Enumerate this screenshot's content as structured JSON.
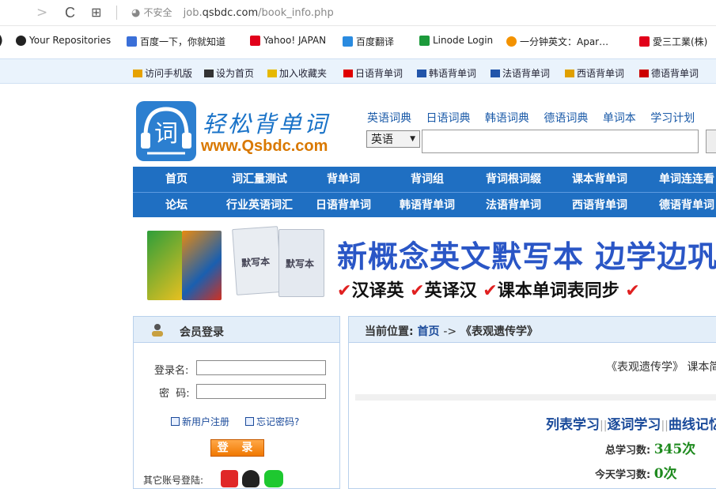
{
  "browser": {
    "back": "<",
    "forward": ">",
    "reload": "C",
    "apps": "⊞",
    "security": "不安全",
    "url_prefix": "job.",
    "url_host": "qsbdc.com",
    "url_path": "/book_info.php"
  },
  "bookmarks": [
    {
      "label": "Your Repositories",
      "icon": "github-icon",
      "color": "#222"
    },
    {
      "label": "百度一下，你就知道",
      "icon": "baidu-icon",
      "color": "#3a6fd8"
    },
    {
      "label": "Yahoo! JAPAN",
      "icon": "yahoo-icon",
      "color": "#e1001a"
    },
    {
      "label": "百度翻译",
      "icon": "translate-icon",
      "color": "#2a8be0"
    },
    {
      "label": "Linode Login",
      "icon": "linode-icon",
      "color": "#1c9a3b"
    },
    {
      "label": "一分钟英文：Apar…",
      "icon": "orange-icon",
      "color": "#f39200"
    },
    {
      "label": "愛三工業(株)",
      "icon": "yahoo-icon",
      "color": "#e1001a"
    }
  ],
  "toplinks": [
    {
      "label": "访问手机版",
      "icon": "mobile-icon",
      "color": "#e6a200"
    },
    {
      "label": "设为首页",
      "icon": "home-icon",
      "color": "#333"
    },
    {
      "label": "加入收藏夹",
      "icon": "folder-icon",
      "color": "#e6b800"
    },
    {
      "label": "日语背单词",
      "icon": "japan-flag-icon",
      "color": "#e00000"
    },
    {
      "label": "韩语背单词",
      "icon": "korea-flag-icon",
      "color": "#2255aa"
    },
    {
      "label": "法语背单词",
      "icon": "france-flag-icon",
      "color": "#2255aa"
    },
    {
      "label": "西语背单词",
      "icon": "spain-flag-icon",
      "color": "#e0a000"
    },
    {
      "label": "德语背单词",
      "icon": "germany-flag-icon",
      "color": "#cc0000"
    }
  ],
  "logo": {
    "glyph": "词",
    "title": "轻松背单词",
    "url": "www.Qsbdc.com"
  },
  "dict_links": [
    "英语词典",
    "日语词典",
    "韩语词典",
    "德语词典",
    "单词本",
    "学习计划"
  ],
  "search": {
    "lang": "英语",
    "arrow": "▼"
  },
  "menu_row1": [
    "首页",
    "词汇量测试",
    "背单词",
    "背词组",
    "背词根词缀",
    "课本背单词",
    "单词连连看"
  ],
  "menu_row2": [
    "论坛",
    "行业英语词汇",
    "日语背单词",
    "韩语背单词",
    "法语背单词",
    "西语背单词",
    "德语背单词"
  ],
  "banner": {
    "headline": "新概念英文默写本 边学边巩固",
    "features": [
      "汉译英",
      "英译汉",
      "课本单词表同步"
    ],
    "check": "✔",
    "book_label": "默写本"
  },
  "login": {
    "title": "会员登录",
    "username_label": "登录名:",
    "password_label": "密  码:",
    "register": "新用户注册",
    "forgot": "忘记密码?",
    "submit": "登 录",
    "other": "其它账号登陆:"
  },
  "content": {
    "location_label": "当前位置:",
    "home": "首页",
    "arrow": "->",
    "current": "《表观遗传学》",
    "course_title": "《表观遗传学》 课本简",
    "study_modes": [
      "列表学习",
      "逐词学习",
      "曲线记忆"
    ],
    "mode_sep": "||",
    "total_label": "总学习数:",
    "total_value": "345次",
    "today_label": "今天学习数:",
    "today_value": "0次"
  }
}
